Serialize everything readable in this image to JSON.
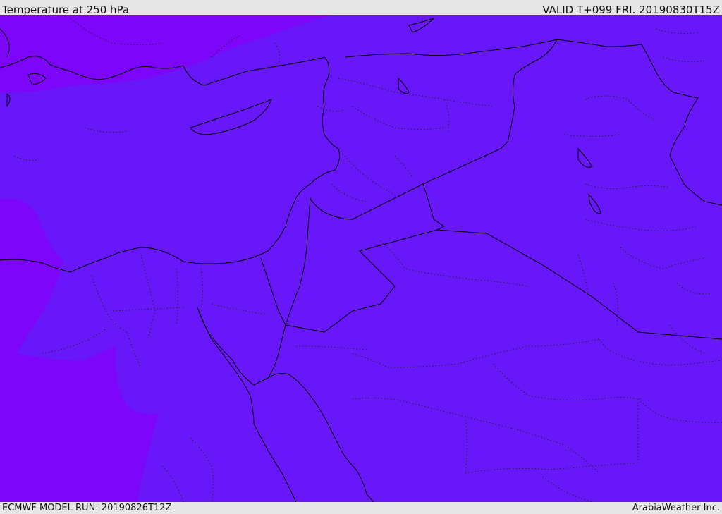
{
  "header": {
    "title": "Temperature at 250 hPa",
    "valid_time": "VALID T+099 FRI. 20190830T15Z"
  },
  "footer": {
    "model_run": "ECMWF MODEL RUN: 20190826T12Z",
    "credit": "ArabiaWeather Inc."
  },
  "map": {
    "field": "temperature",
    "level": "250 hPa",
    "colors": {
      "main_fill": "#6818f8",
      "cold_fill": "#7c05fa",
      "coastline": "#000000",
      "borders_dotted": "#222222"
    }
  }
}
